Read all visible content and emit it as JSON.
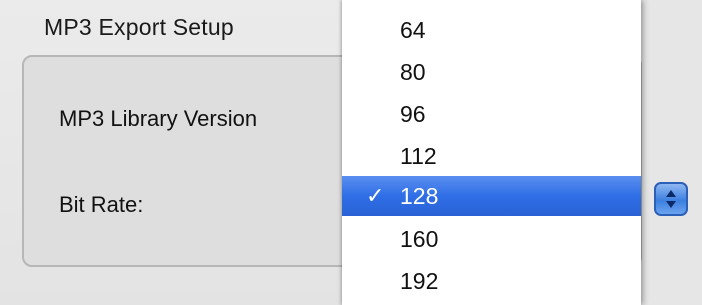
{
  "dialog": {
    "group_title": "MP3 Export Setup",
    "library_label": "MP3 Library Version",
    "bitrate_label": "Bit Rate:"
  },
  "bitrate_menu": {
    "selected_value": "128",
    "check_glyph": "✓",
    "options": [
      "64",
      "80",
      "96",
      "112",
      "128",
      "160",
      "192"
    ]
  },
  "colors": {
    "selection": "#2f6ee6",
    "menu_bg": "#ffffff",
    "window_bg": "#e6e6e6"
  },
  "icons": {
    "popup_arrows": "up-down-arrows-icon",
    "checkmark": "checkmark-icon"
  }
}
